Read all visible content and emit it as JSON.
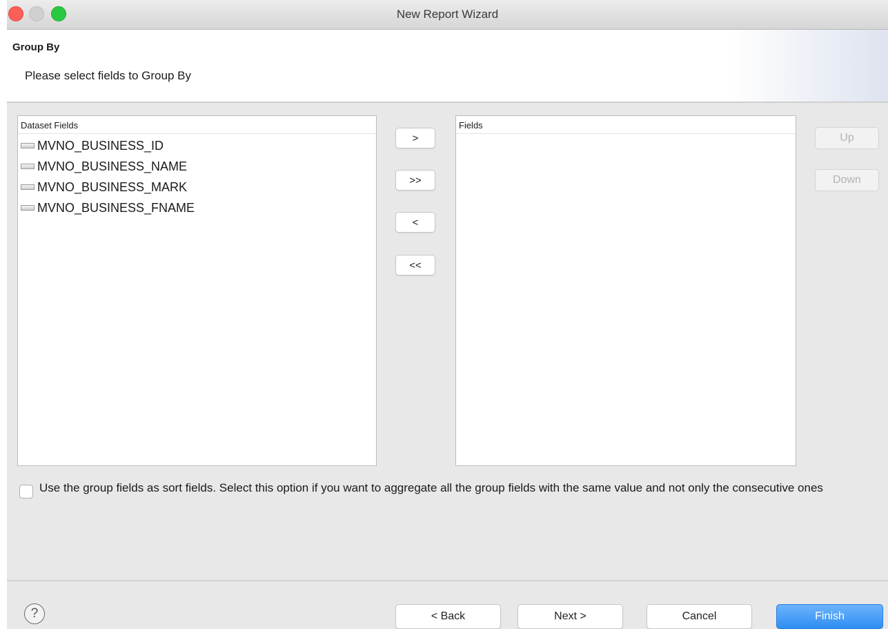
{
  "window": {
    "title": "New Report Wizard"
  },
  "header": {
    "title": "Group By",
    "description": "Please select fields to Group By"
  },
  "dataset_list": {
    "header": "Dataset Fields",
    "items": [
      {
        "label": "MVNO_BUSINESS_ID",
        "icon": "field-icon"
      },
      {
        "label": "MVNO_BUSINESS_NAME",
        "icon": "field-icon"
      },
      {
        "label": "MVNO_BUSINESS_MARK",
        "icon": "field-icon"
      },
      {
        "label": "MVNO_BUSINESS_FNAME",
        "icon": "field-icon"
      }
    ]
  },
  "transfer_buttons": {
    "add": ">",
    "add_all": ">>",
    "remove": "<",
    "remove_all": "<<"
  },
  "fields_list": {
    "header": "Fields",
    "items": []
  },
  "order_buttons": {
    "up": "Up",
    "down": "Down",
    "enabled": false
  },
  "sort_option": {
    "checked": false,
    "label": "Use the group fields as sort fields. Select this option if you want to aggregate all the group fields with the same value and not only the consecutive ones"
  },
  "footer": {
    "help_icon": "question-mark-icon",
    "back": "< Back",
    "next": "Next >",
    "cancel": "Cancel",
    "finish": "Finish"
  },
  "colors": {
    "primary_button": "#2f8ef3",
    "close_button": "#fc5f57",
    "maximize_button": "#28c940"
  }
}
